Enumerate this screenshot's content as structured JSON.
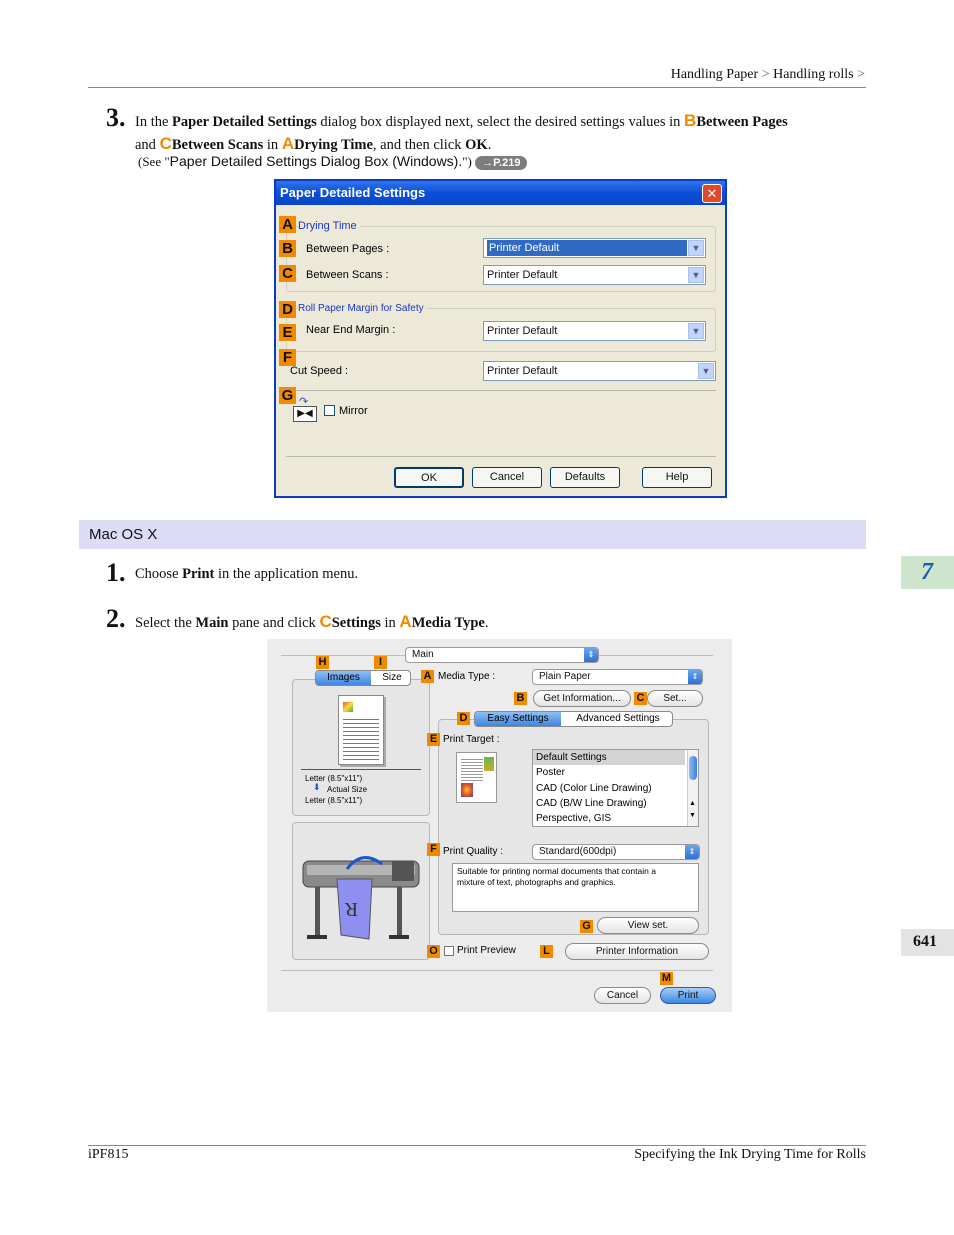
{
  "header": {
    "breadcrumb_1": "Handling Paper",
    "sep_1": ">",
    "breadcrumb_2": "Handling rolls",
    "sep_2": ">"
  },
  "step3": {
    "number": "3.",
    "t1": "In the ",
    "b1": "Paper Detailed Settings",
    "t2": " dialog box displayed next, select the desired settings values in ",
    "m1": "B",
    "b2": "Between Pages",
    "t3": "and ",
    "m2": "C",
    "b3": "Between Scans",
    "t4": " in ",
    "m3": "A",
    "b4": "Drying Time",
    "t5": ", and then click ",
    "b5": "OK",
    "t6": ".",
    "see_prefix": "(See \"",
    "see_link": "Paper Detailed Settings Dialog Box (Windows).",
    "see_suffix": "\")",
    "page_badge": "→P.219"
  },
  "win_dialog": {
    "title": "Paper Detailed Settings",
    "close": "✕",
    "labels": [
      "A",
      "B",
      "C",
      "D",
      "E",
      "F",
      "G"
    ],
    "drying_time": "Drying Time",
    "between_pages": "Between Pages :",
    "between_scans": "Between Scans :",
    "roll_margin": "Roll Paper Margin for Safety",
    "near_end_margin": "Near End Margin :",
    "cut_speed": "Cut Speed :",
    "mirror": "Mirror",
    "select_value": "Printer Default",
    "buttons": {
      "ok": "OK",
      "cancel": "Cancel",
      "defaults": "Defaults",
      "help": "Help"
    }
  },
  "mac_section": {
    "title": "Mac OS X"
  },
  "side_tab": {
    "chapter": "7",
    "page": "641"
  },
  "step1": {
    "number": "1.",
    "t1": "Choose ",
    "b1": "Print",
    "t2": " in the application menu."
  },
  "step2": {
    "number": "2.",
    "t1": "Select the ",
    "b1": "Main",
    "t2": " pane and click ",
    "m1": "C",
    "b2": "Settings",
    "t3": " in ",
    "m2": "A",
    "b3": "Media Type",
    "t4": "."
  },
  "mac_dialog": {
    "pane": "Main",
    "tab_images": "Images",
    "tab_size": "Size",
    "media_type_label": "Media Type :",
    "media_type_value": "Plain Paper",
    "get_info": "Get Information...",
    "set": "Set...",
    "tab_easy": "Easy Settings",
    "tab_advanced": "Advanced Settings",
    "print_target": "Print Target :",
    "targets": [
      "Default Settings",
      "Poster",
      "CAD (Color Line Drawing)",
      "CAD (B/W Line Drawing)",
      "Perspective, GIS"
    ],
    "paper_info_1": "Letter (8.5\"x11\")",
    "actual_size": "Actual Size",
    "paper_info_2": "Letter (8.5\"x11\")",
    "print_quality_label": "Print Quality :",
    "print_quality_value": "Standard(600dpi)",
    "description": "Suitable for printing normal documents that contain a mixture of text, photographs and graphics.",
    "view_set": "View set.",
    "print_preview": "Print Preview",
    "printer_info": "Printer Information",
    "cancel": "Cancel",
    "print": "Print",
    "labels": {
      "H": "H",
      "I": "I",
      "A": "A",
      "B": "B",
      "C": "C",
      "D": "D",
      "E": "E",
      "F": "F",
      "G": "G",
      "O": "O",
      "L": "L",
      "M": "M"
    }
  },
  "footer": {
    "left": "iPF815",
    "right": "Specifying the Ink Drying Time for Rolls"
  }
}
